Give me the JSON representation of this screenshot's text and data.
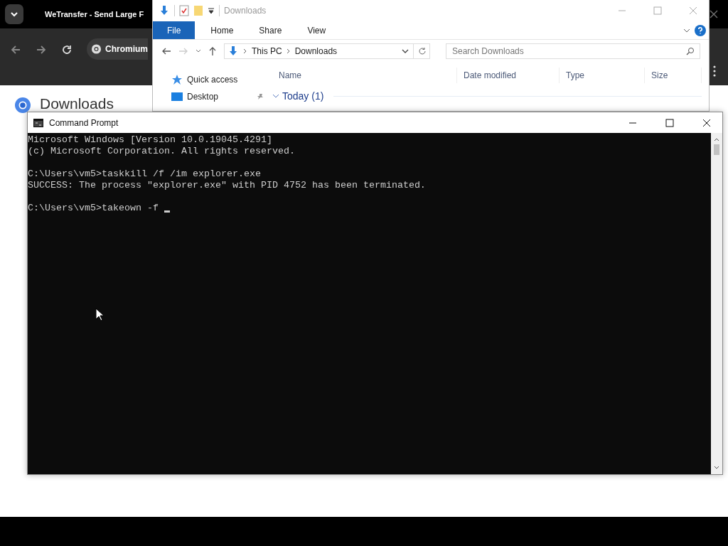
{
  "browser": {
    "tab_title": "WeTransfer - Send Large F",
    "omnibox_chip": "Chromium",
    "page_heading": "Downloads"
  },
  "explorer": {
    "title": "Downloads",
    "ribbon_tabs": [
      {
        "label": "File",
        "selected": true
      },
      {
        "label": "Home",
        "selected": false
      },
      {
        "label": "Share",
        "selected": false
      },
      {
        "label": "View",
        "selected": false
      }
    ],
    "address": [
      "This PC",
      "Downloads"
    ],
    "search": {
      "placeholder": "Search Downloads"
    },
    "nav_items": [
      {
        "label": "Quick access",
        "kind": "star"
      },
      {
        "label": "Desktop",
        "kind": "desktop"
      }
    ],
    "columns": [
      "Name",
      "Date modified",
      "Type",
      "Size"
    ],
    "groups": [
      {
        "label": "Today (1)",
        "expanded": true
      }
    ]
  },
  "console": {
    "title": "Command Prompt",
    "blocks": [
      [
        "Microsoft Windows [Version 10.0.19045.4291]",
        "(c) Microsoft Corporation. All rights reserved."
      ],
      [
        "C:\\Users\\vm5>taskkill /f /im explorer.exe",
        "SUCCESS: The process \"explorer.exe\" with PID 4752 has been terminated."
      ],
      [
        "C:\\Users\\vm5>takeown -f"
      ]
    ]
  }
}
